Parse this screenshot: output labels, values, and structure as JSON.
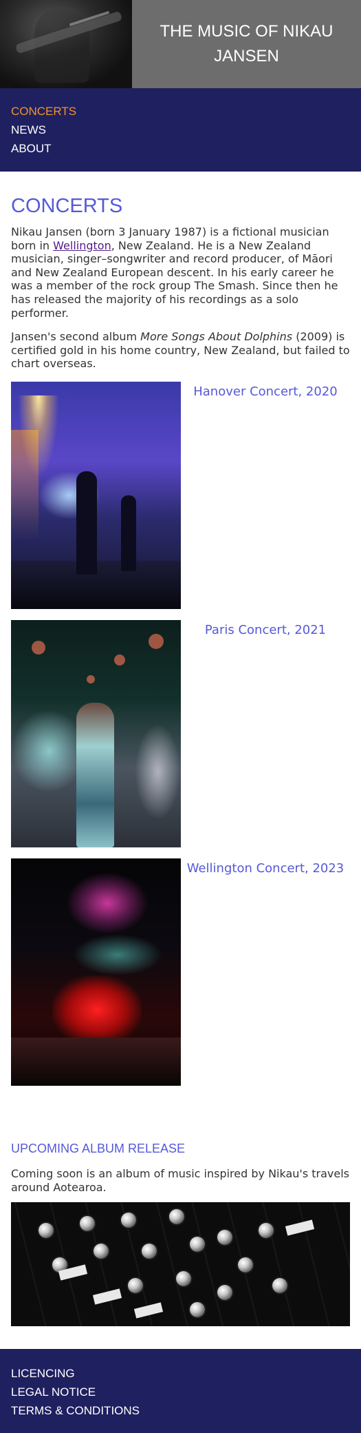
{
  "header": {
    "title": "THE MUSIC OF NIKAU JANSEN",
    "photo_description_icon": "guitarist-photo"
  },
  "nav": {
    "items": [
      {
        "label": "CONCERTS",
        "active": true
      },
      {
        "label": "NEWS",
        "active": false
      },
      {
        "label": "ABOUT",
        "active": false
      }
    ]
  },
  "main": {
    "heading": "CONCERTS",
    "intro": {
      "before_link": "Nikau Jansen (born 3 January 1987) is a fictional musician born in ",
      "link": "Wellington",
      "after_link": ", New Zealand. He is a New Zealand musician, singer–songwriter and record producer, of Māori and New Zealand European descent. In his early career he was a member of the rock group The Smash. Since then he has released the majority of his recordings as a solo performer."
    },
    "album": {
      "before": "Jansen's second album ",
      "title": "More Songs About Dolphins",
      "after": " (2009) is certified gold in his home country, New Zealand, but failed to chart overseas."
    },
    "concerts": [
      {
        "caption": "Hanover Concert, 2020"
      },
      {
        "caption": "Paris Concert, 2021"
      },
      {
        "caption": "Wellington Concert, 2023"
      }
    ],
    "upcoming": {
      "heading": "UPCOMING ALBUM RELEASE",
      "text": "Coming soon is an album of music inspired by Nikau's travels around Aotearoa."
    }
  },
  "footer": {
    "links": [
      "LICENCING",
      "LEGAL NOTICE",
      "TERMS & CONDITIONS"
    ]
  },
  "colors": {
    "nav_bg": "#1f2060",
    "accent": "#5559d8",
    "active_nav": "#f0922b",
    "header_title_bg": "#6d6d6d"
  }
}
